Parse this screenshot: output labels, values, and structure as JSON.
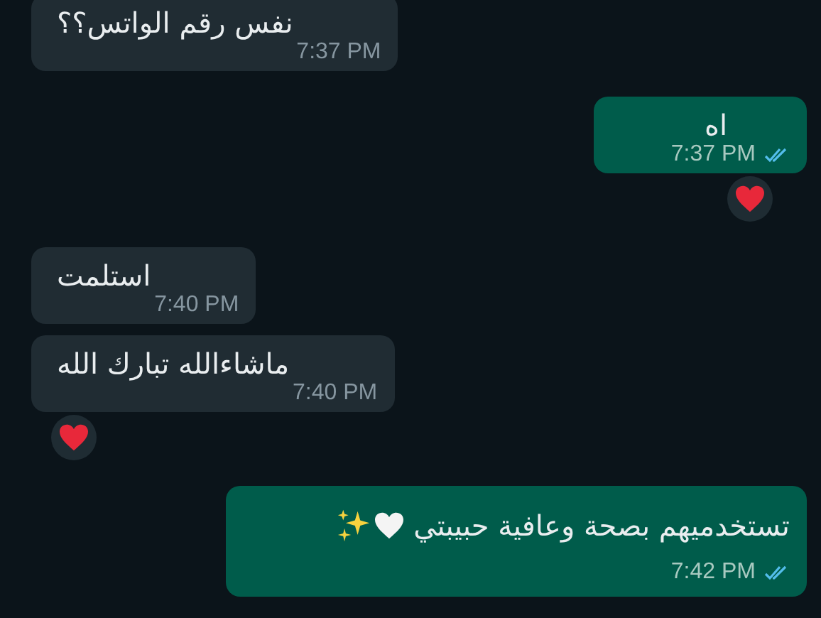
{
  "messages": [
    {
      "kind": "incoming",
      "text": "نفس رقم الواتس؟؟",
      "time": "7:37 PM"
    },
    {
      "kind": "outgoing",
      "text": "اه",
      "time": "7:37 PM",
      "read": true,
      "reacted": true
    },
    {
      "kind": "incoming",
      "text": "استلمت",
      "time": "7:40 PM"
    },
    {
      "kind": "incoming",
      "text": "ماشاءالله تبارك الله",
      "time": "7:40 PM",
      "reacted": true
    },
    {
      "kind": "outgoing",
      "text": "تستخدميهم بصحة وعافية حبيبتي",
      "time": "7:42 PM",
      "read": true,
      "emoji": true
    }
  ]
}
